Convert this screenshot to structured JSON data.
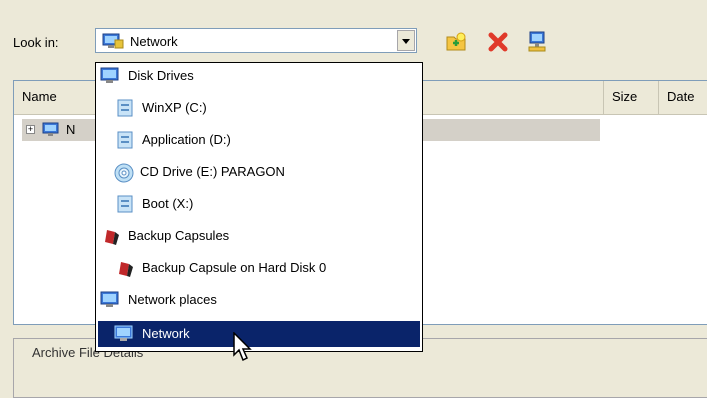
{
  "toolbar": {
    "lookin_label": "Look in:",
    "combo_value": "Network",
    "combo_icon": "network-icon",
    "buttons": [
      {
        "name": "new-folder-icon"
      },
      {
        "name": "delete-icon"
      },
      {
        "name": "map-network-drive-icon"
      }
    ]
  },
  "list": {
    "headers": [
      "Name",
      "Size",
      "Date"
    ],
    "tree_row_label": "N"
  },
  "group": {
    "label": "Archive File Details"
  },
  "dropdown": {
    "items": [
      {
        "label": "Disk Drives",
        "icon": "monitor-icon",
        "level": 0,
        "selected": false
      },
      {
        "label": "WinXP (C:)",
        "icon": "hard-drive-icon",
        "level": 1,
        "selected": false
      },
      {
        "label": "Application (D:)",
        "icon": "hard-drive-icon",
        "level": 1,
        "selected": false
      },
      {
        "label": "CD Drive (E:) PARAGON",
        "icon": "cd-drive-icon",
        "level": 1,
        "selected": false
      },
      {
        "label": "Boot (X:)",
        "icon": "hard-drive-icon",
        "level": 1,
        "selected": false
      },
      {
        "label": "Backup Capsules",
        "icon": "backup-capsule-icon",
        "level": 0,
        "selected": false
      },
      {
        "label": "Backup Capsule on Hard Disk 0",
        "icon": "backup-capsule-icon",
        "level": 1,
        "selected": false
      },
      {
        "label": "Network places",
        "icon": "monitor-icon",
        "level": 0,
        "selected": false
      },
      {
        "label": "Network",
        "icon": "network-icon",
        "level": 1,
        "selected": true
      }
    ]
  },
  "colors": {
    "selection": "#0a246a",
    "window_bg": "#ece9d8",
    "monitor_blue": "#3b78d8"
  }
}
